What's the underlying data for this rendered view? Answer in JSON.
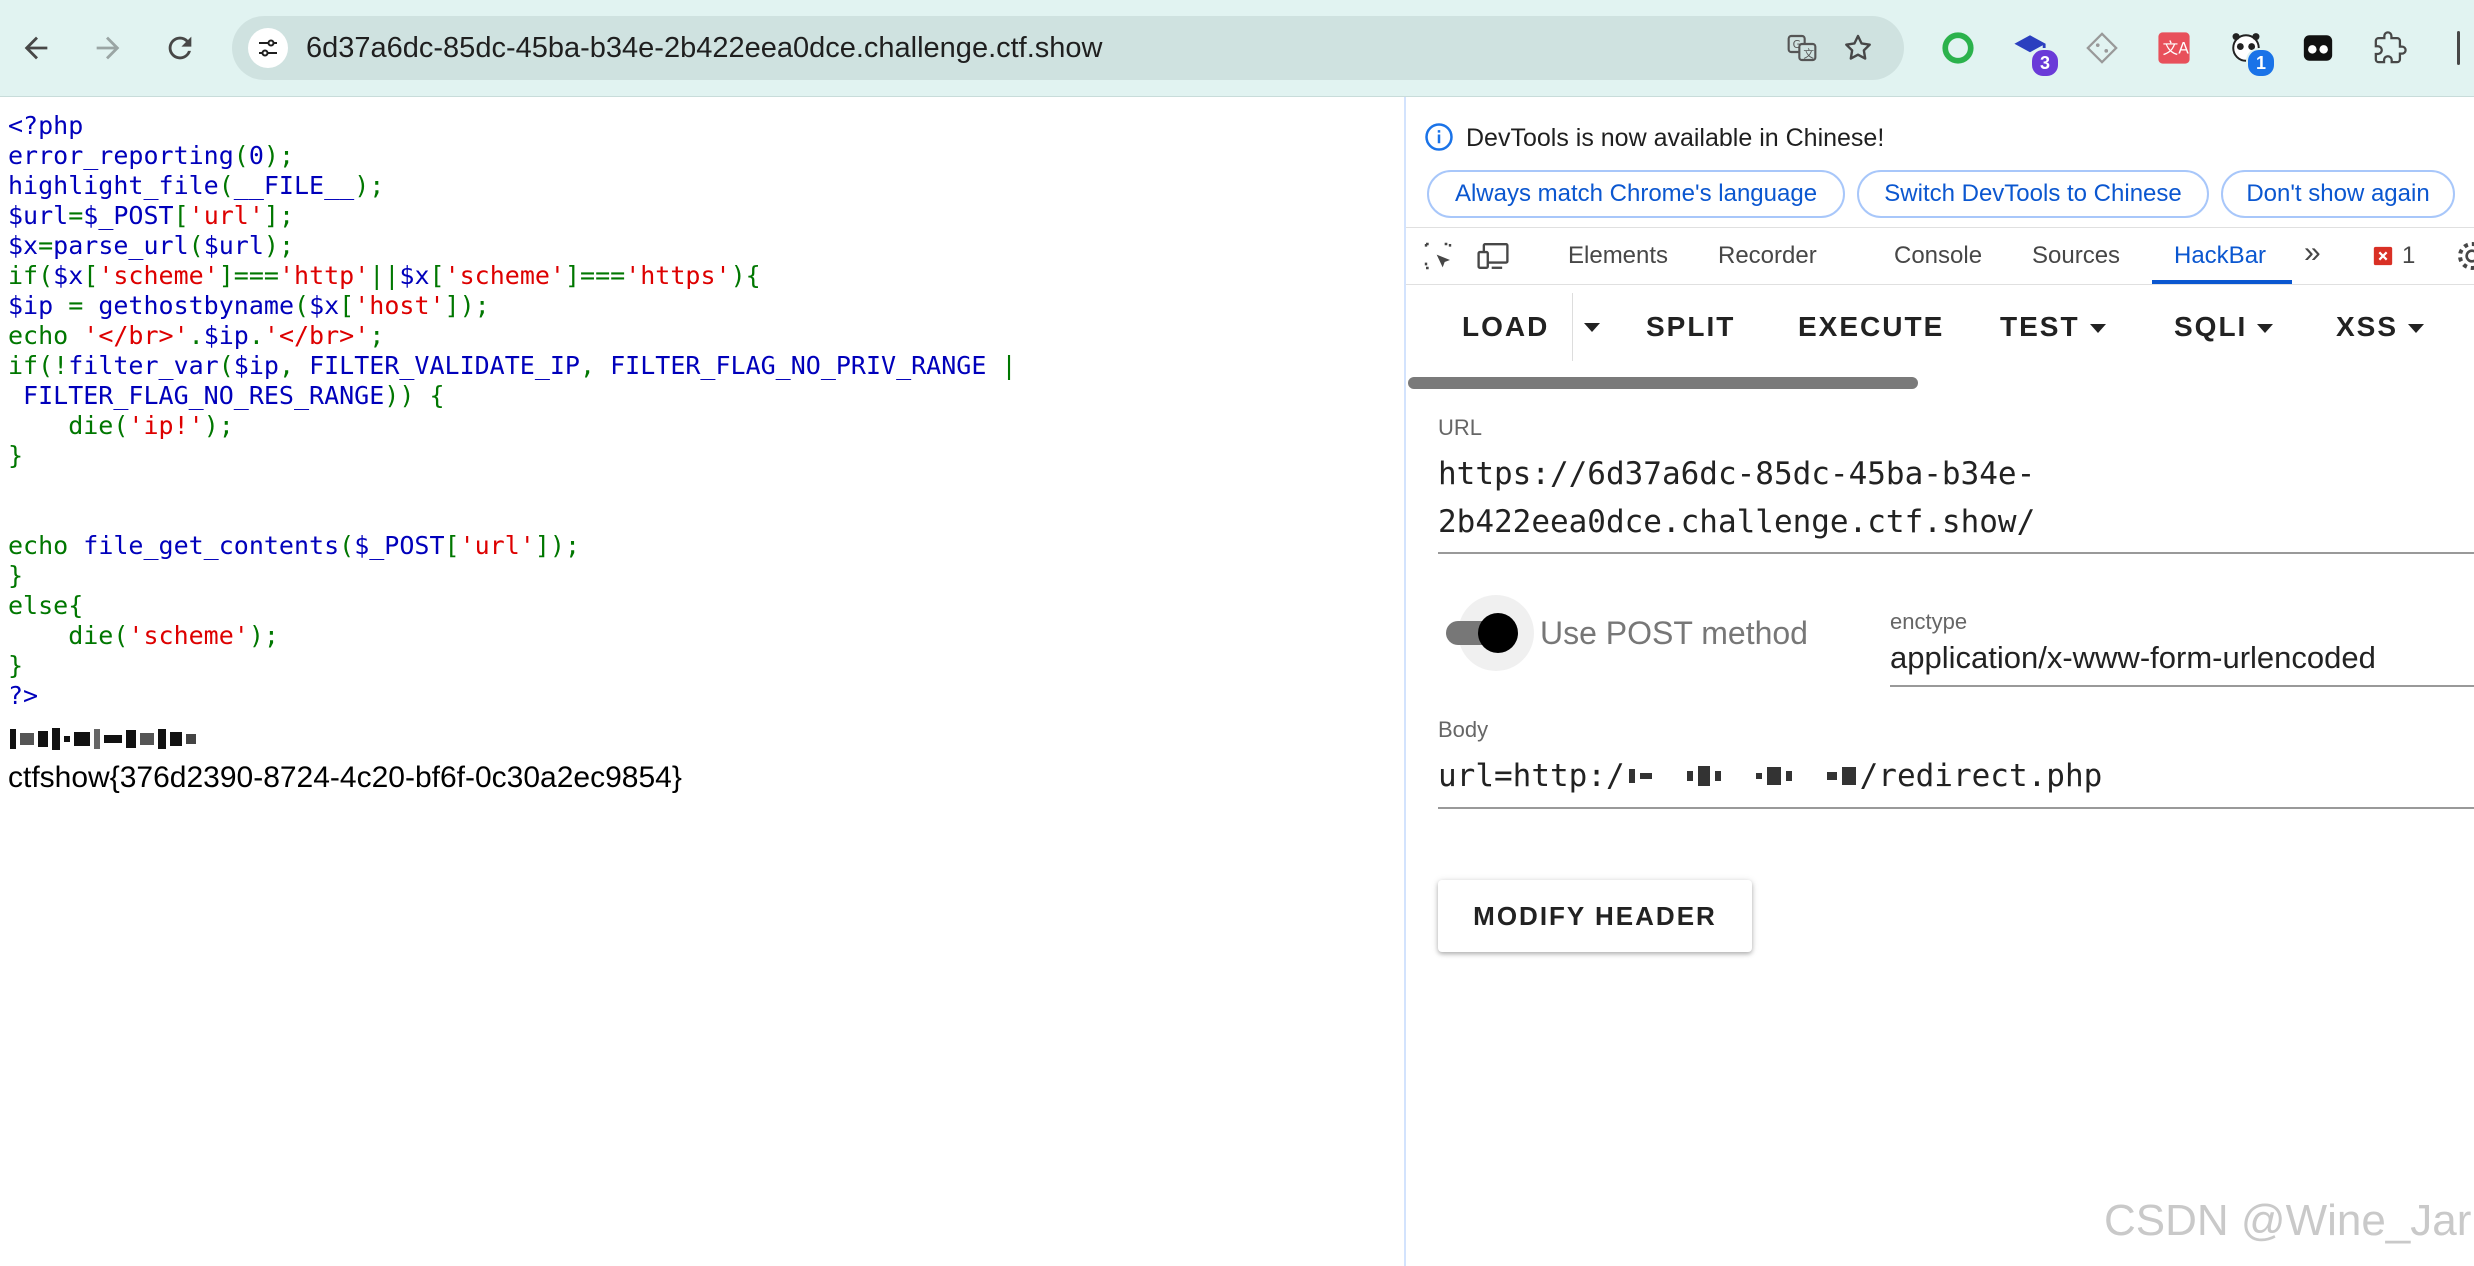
{
  "browser": {
    "url": "6d37a6dc-85dc-45ba-b34e-2b422eea0dce.challenge.ctf.show",
    "extensions": [
      {
        "name": "green-circle-extension-icon"
      },
      {
        "name": "graduation-cap-extension-icon",
        "badge": "3"
      },
      {
        "name": "diamond-extension-icon"
      },
      {
        "name": "translate-extension-icon"
      },
      {
        "name": "panda-extension-icon",
        "badge": "1"
      },
      {
        "name": "mask-extension-icon"
      },
      {
        "name": "puzzle-extension-icon"
      }
    ],
    "accent_color": "#e1f3f1"
  },
  "page": {
    "code_lines": [
      [
        {
          "t": "<?php",
          "c": "def"
        }
      ],
      [
        {
          "t": "error_reporting",
          "c": "def"
        },
        {
          "t": "(",
          "c": "kw"
        },
        {
          "t": "0",
          "c": "def"
        },
        {
          "t": ");",
          "c": "kw"
        }
      ],
      [
        {
          "t": "highlight_file",
          "c": "def"
        },
        {
          "t": "(",
          "c": "kw"
        },
        {
          "t": "__FILE__",
          "c": "def"
        },
        {
          "t": ");",
          "c": "kw"
        }
      ],
      [
        {
          "t": "$url",
          "c": "def"
        },
        {
          "t": "=",
          "c": "kw"
        },
        {
          "t": "$_POST",
          "c": "def"
        },
        {
          "t": "[",
          "c": "kw"
        },
        {
          "t": "'url'",
          "c": "str"
        },
        {
          "t": "];",
          "c": "kw"
        }
      ],
      [
        {
          "t": "$x",
          "c": "def"
        },
        {
          "t": "=",
          "c": "kw"
        },
        {
          "t": "parse_url",
          "c": "def"
        },
        {
          "t": "(",
          "c": "kw"
        },
        {
          "t": "$url",
          "c": "def"
        },
        {
          "t": ");",
          "c": "kw"
        }
      ],
      [
        {
          "t": "if(",
          "c": "kw"
        },
        {
          "t": "$x",
          "c": "def"
        },
        {
          "t": "[",
          "c": "kw"
        },
        {
          "t": "'scheme'",
          "c": "str"
        },
        {
          "t": "]===",
          "c": "kw"
        },
        {
          "t": "'http'",
          "c": "str"
        },
        {
          "t": "||",
          "c": "kw"
        },
        {
          "t": "$x",
          "c": "def"
        },
        {
          "t": "[",
          "c": "kw"
        },
        {
          "t": "'scheme'",
          "c": "str"
        },
        {
          "t": "]===",
          "c": "kw"
        },
        {
          "t": "'https'",
          "c": "str"
        },
        {
          "t": "){",
          "c": "kw"
        }
      ],
      [
        {
          "t": "$ip ",
          "c": "def"
        },
        {
          "t": "= ",
          "c": "kw"
        },
        {
          "t": "gethostbyname",
          "c": "def"
        },
        {
          "t": "(",
          "c": "kw"
        },
        {
          "t": "$x",
          "c": "def"
        },
        {
          "t": "[",
          "c": "kw"
        },
        {
          "t": "'host'",
          "c": "str"
        },
        {
          "t": "]);",
          "c": "kw"
        }
      ],
      [
        {
          "t": "echo ",
          "c": "kw"
        },
        {
          "t": "'</br>'",
          "c": "str"
        },
        {
          "t": ".",
          "c": "kw"
        },
        {
          "t": "$ip",
          "c": "def"
        },
        {
          "t": ".",
          "c": "kw"
        },
        {
          "t": "'</br>'",
          "c": "str"
        },
        {
          "t": ";",
          "c": "kw"
        }
      ],
      [
        {
          "t": "if(!",
          "c": "kw"
        },
        {
          "t": "filter_var",
          "c": "def"
        },
        {
          "t": "(",
          "c": "kw"
        },
        {
          "t": "$ip",
          "c": "def"
        },
        {
          "t": ", ",
          "c": "kw"
        },
        {
          "t": "FILTER_VALIDATE_IP",
          "c": "def"
        },
        {
          "t": ", ",
          "c": "kw"
        },
        {
          "t": "FILTER_FLAG_NO_PRIV_RANGE ",
          "c": "def"
        },
        {
          "t": "|",
          "c": "kw"
        }
      ],
      [
        {
          "t": " FILTER_FLAG_NO_RES_RANGE",
          "c": "def"
        },
        {
          "t": ")) {",
          "c": "kw"
        }
      ],
      [
        {
          "t": "    die(",
          "c": "kw"
        },
        {
          "t": "'ip!'",
          "c": "str"
        },
        {
          "t": ");",
          "c": "kw"
        }
      ],
      [
        {
          "t": "}",
          "c": "kw"
        }
      ],
      [],
      [],
      [
        {
          "t": "echo ",
          "c": "kw"
        },
        {
          "t": "file_get_contents",
          "c": "def"
        },
        {
          "t": "(",
          "c": "kw"
        },
        {
          "t": "$_POST",
          "c": "def"
        },
        {
          "t": "[",
          "c": "kw"
        },
        {
          "t": "'url'",
          "c": "str"
        },
        {
          "t": "]);",
          "c": "kw"
        }
      ],
      [
        {
          "t": "}",
          "c": "kw"
        }
      ],
      [
        {
          "t": "else{",
          "c": "kw"
        }
      ],
      [
        {
          "t": "    die(",
          "c": "kw"
        },
        {
          "t": "'scheme'",
          "c": "str"
        },
        {
          "t": ");",
          "c": "kw"
        }
      ],
      [
        {
          "t": "}",
          "c": "kw"
        }
      ],
      [
        {
          "t": "?>",
          "c": "def"
        }
      ]
    ],
    "flag": "ctfshow{376d2390-8724-4c20-bf6f-0c30a2ec9854}",
    "syntax_colors": {
      "default": "#0000BB",
      "keyword": "#007700",
      "string": "#DD0000"
    }
  },
  "devtools": {
    "info_text": "DevTools is now available in Chinese!",
    "pills": [
      "Always match Chrome's language",
      "Switch DevTools to Chinese",
      "Don't show again"
    ],
    "tabs": [
      "Elements",
      "Recorder",
      "Console",
      "Sources",
      "HackBar"
    ],
    "active_tab": "HackBar",
    "issues_count": "1",
    "hackbar": {
      "menu": {
        "load": "LOAD",
        "split": "SPLIT",
        "execute": "EXECUTE",
        "test": "TEST",
        "sqli": "SQLI",
        "xss": "XSS"
      },
      "url_label": "URL",
      "url_line1": "https://6d37a6dc-85dc-45ba-b34e-",
      "url_line2": "2b422eea0dce.challenge.ctf.show/",
      "post_label": "Use POST method",
      "post_enabled": true,
      "enctype_label": "enctype",
      "enctype_value": "application/x-www-form-urlencoded",
      "body_label": "Body",
      "body_prefix": "url=http:/",
      "body_suffix": "/redirect.php",
      "modify_header": "MODIFY HEADER"
    }
  },
  "watermark": "CSDN @Wine_Jar"
}
